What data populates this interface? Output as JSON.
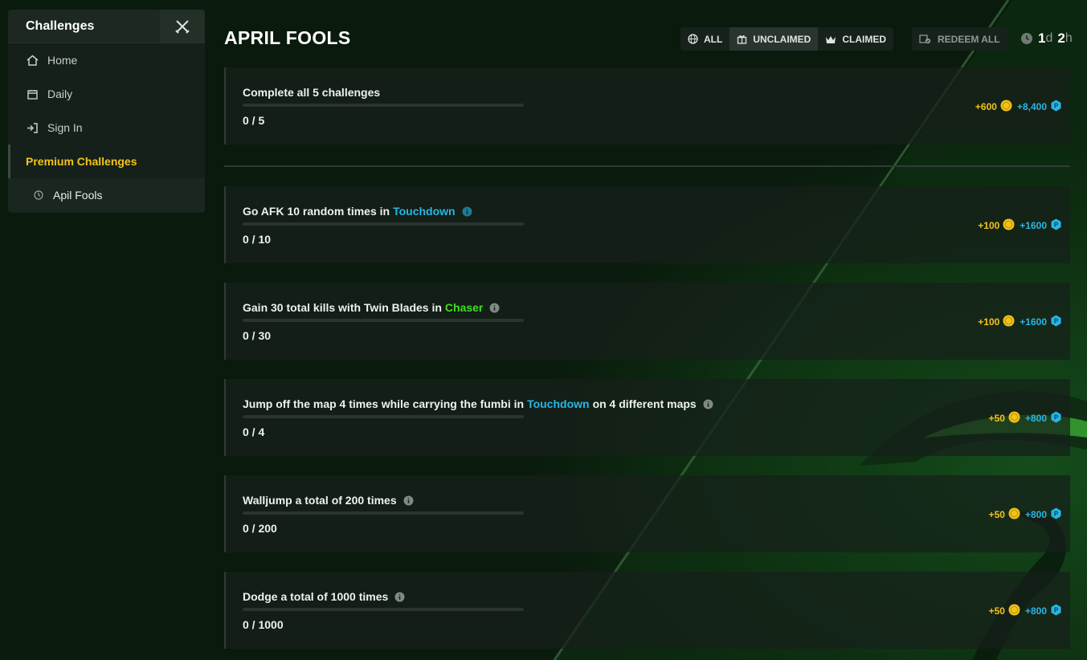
{
  "sidebar": {
    "title": "Challenges",
    "items": [
      {
        "label": "Home",
        "icon": "home-icon"
      },
      {
        "label": "Daily",
        "icon": "calendar-icon"
      },
      {
        "label": "Sign In",
        "icon": "sign-in-icon"
      }
    ],
    "premium_label": "Premium Challenges",
    "sub_item": {
      "label": "Apil Fools",
      "icon": "clock-icon"
    }
  },
  "header": {
    "title": "APRIL FOOLS",
    "filters": [
      {
        "label": "ALL",
        "icon": "globe-icon"
      },
      {
        "label": "UNCLAIMED",
        "icon": "gift-icon",
        "active": true
      },
      {
        "label": "CLAIMED",
        "icon": "crown-icon"
      }
    ],
    "redeem_label": "REDEEM ALL",
    "timer": {
      "days": "1",
      "days_unit": "d",
      "hours": "2",
      "hours_unit": "h"
    }
  },
  "challenges": [
    {
      "title": "Complete all 5 challenges",
      "progress": "0 / 5",
      "progress_fraction": 0,
      "coins": "+600",
      "gems": "+8,400"
    },
    {
      "title": "Go AFK 10 random times in",
      "highlight": "Touchdown",
      "highlight_color": "#27b7e6",
      "after": "",
      "progress": "0 / 10",
      "progress_fraction": 0,
      "coins": "+100",
      "gems": "+1600"
    },
    {
      "title": "Gain 30 total kills with Twin Blades in",
      "highlight": "Chaser",
      "highlight_color": "#3ee01f",
      "after": "",
      "progress": "0 / 30",
      "progress_fraction": 0,
      "coins": "+100",
      "gems": "+1600"
    },
    {
      "title": "Jump off the map 4 times while carrying the fumbi in",
      "highlight": "Touchdown",
      "highlight_color": "#27b7e6",
      "after": "on 4 different maps",
      "progress": "0 / 4",
      "progress_fraction": 0,
      "coins": "+50",
      "gems": "+800"
    },
    {
      "title": "Walljump a total of 200 times",
      "progress": "0 / 200",
      "progress_fraction": 0,
      "coins": "+50",
      "gems": "+800"
    },
    {
      "title": "Dodge a total of 1000 times",
      "progress": "0 / 1000",
      "progress_fraction": 0,
      "coins": "+50",
      "gems": "+800"
    }
  ],
  "colors": {
    "accent_yellow": "#f3c418",
    "accent_blue": "#27b7e6",
    "accent_green": "#3ee01f"
  }
}
